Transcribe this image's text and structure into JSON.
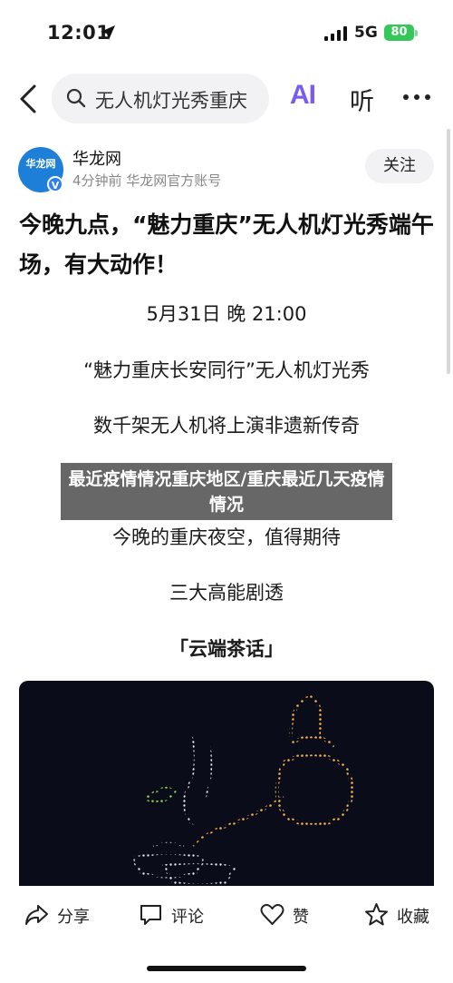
{
  "status_bar": {
    "time": "12:01",
    "network": "5G",
    "battery": "80"
  },
  "nav": {
    "search_query": "无人机灯光秀重庆",
    "ai_label": "AI",
    "listen_label": "听"
  },
  "author": {
    "avatar_text": "华龙网",
    "name": "华龙网",
    "meta": "4分钟前  华龙网官方账号",
    "follow_label": "关注"
  },
  "article": {
    "title": "今晚九点，“魅力重庆”无人机灯光秀端午场，有大动作！",
    "lines": [
      "5月31日 晚 21:00",
      "“魅力重庆长安同行”无人机灯光秀",
      "数千架无人机将上演非遗新传奇",
      "今晚的重庆夜空，值得期待",
      "三大高能剧透",
      "「云端茶话」"
    ]
  },
  "overlay": {
    "text": "最近疫情情况重庆地区/重庆最近几天疫情情况"
  },
  "actions": {
    "share": "分享",
    "comment": "评论",
    "like": "赞",
    "favorite": "收藏"
  }
}
